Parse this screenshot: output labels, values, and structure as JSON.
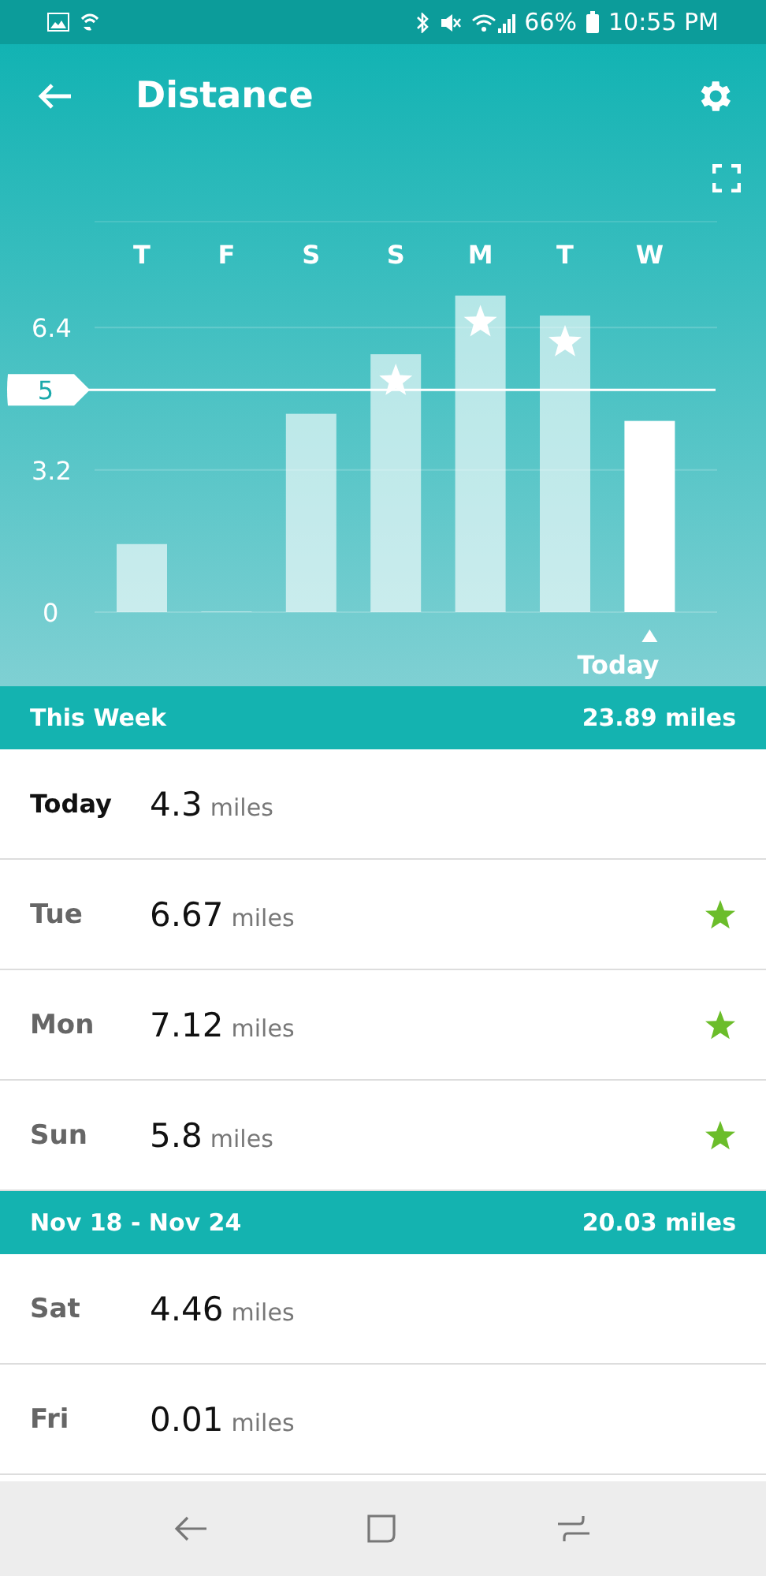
{
  "status_bar": {
    "battery": "66%",
    "time": "10:55 PM"
  },
  "header": {
    "title": "Distance"
  },
  "chart": {
    "chart_data": {
      "type": "bar",
      "categories": [
        "T",
        "F",
        "S",
        "S",
        "M",
        "T",
        "W"
      ],
      "values": [
        1.53,
        0.01,
        4.46,
        5.8,
        7.12,
        6.67,
        4.3
      ],
      "ylim": [
        0,
        8.8
      ],
      "yticks": [
        0,
        3.2,
        6.4
      ],
      "ref_lines": [
        {
          "axis": "y",
          "value": 5,
          "label": "5"
        }
      ]
    },
    "bars": [
      {
        "starred": false,
        "selected": false
      },
      {
        "starred": false,
        "selected": false
      },
      {
        "starred": false,
        "selected": false
      },
      {
        "starred": true,
        "selected": false
      },
      {
        "starred": true,
        "selected": false
      },
      {
        "starred": true,
        "selected": false
      },
      {
        "starred": false,
        "selected": true
      }
    ],
    "today_label": "Today"
  },
  "sections": [
    {
      "title": "This Week",
      "total": "23.89 miles",
      "rows": [
        {
          "day": "Today",
          "value": "4.3",
          "unit": "miles",
          "starred": false,
          "selected": true
        },
        {
          "day": "Tue",
          "value": "6.67",
          "unit": "miles",
          "starred": true,
          "selected": false
        },
        {
          "day": "Mon",
          "value": "7.12",
          "unit": "miles",
          "starred": true,
          "selected": false
        },
        {
          "day": "Sun",
          "value": "5.8",
          "unit": "miles",
          "starred": true,
          "selected": false
        }
      ]
    },
    {
      "title": "Nov 18 - Nov 24",
      "total": "20.03 miles",
      "rows": [
        {
          "day": "Sat",
          "value": "4.46",
          "unit": "miles",
          "starred": false,
          "selected": false
        },
        {
          "day": "Fri",
          "value": "0.01",
          "unit": "miles",
          "starred": false,
          "selected": false
        }
      ]
    }
  ]
}
